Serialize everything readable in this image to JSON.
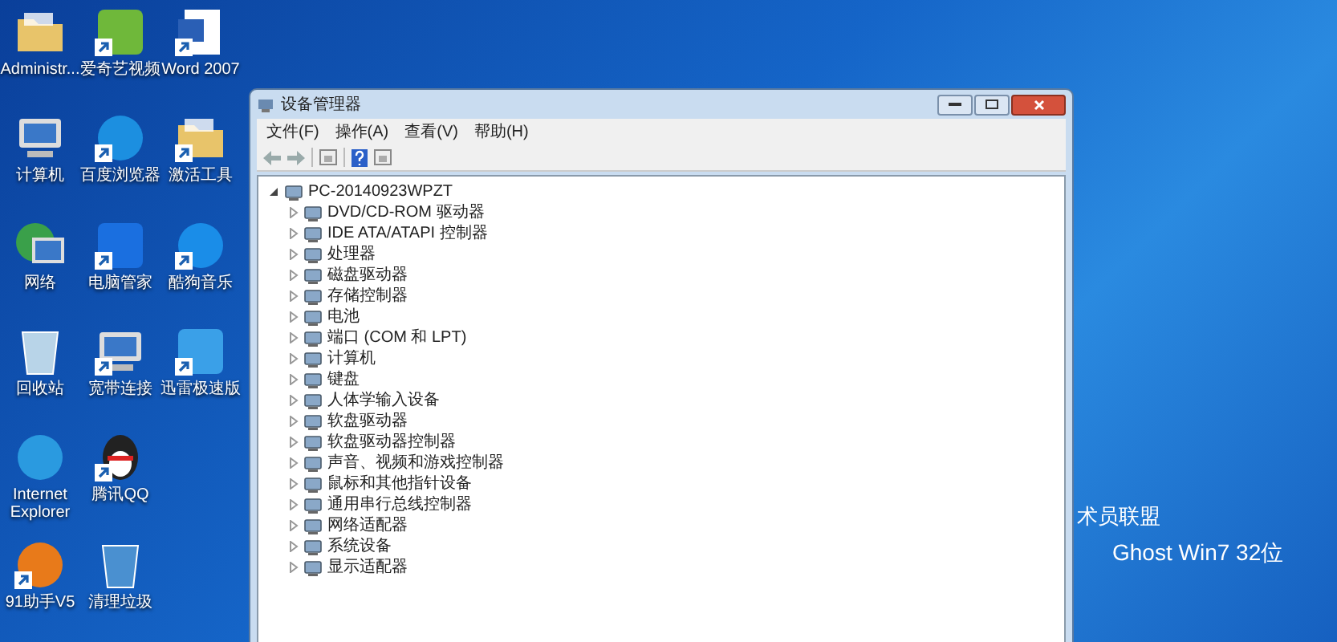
{
  "desktop_rows": [
    [
      {
        "label": "Administr...",
        "kind": "folder",
        "color": "#e8c46a",
        "shortcut": false
      },
      {
        "label": "爱奇艺视频",
        "kind": "tile",
        "color": "#6fb83a",
        "shortcut": true
      },
      {
        "label": "Word 2007",
        "kind": "doc",
        "color": "#2a5fb5",
        "shortcut": true
      }
    ],
    [
      {
        "label": "计算机",
        "kind": "computer",
        "color": "#3a78c8",
        "shortcut": false
      },
      {
        "label": "百度浏览器",
        "kind": "round",
        "color": "#1c8fe0",
        "shortcut": true
      },
      {
        "label": "激活工具",
        "kind": "folder",
        "color": "#e8c46a",
        "shortcut": true
      }
    ],
    [
      {
        "label": "网络",
        "kind": "globe",
        "color": "#3aa04a",
        "shortcut": false
      },
      {
        "label": "电脑管家",
        "kind": "tile",
        "color": "#1a6fe0",
        "shortcut": true
      },
      {
        "label": "酷狗音乐",
        "kind": "round",
        "color": "#1a8de8",
        "shortcut": true
      }
    ],
    [
      {
        "label": "回收站",
        "kind": "bin",
        "color": "#b8d4e8",
        "shortcut": false
      },
      {
        "label": "宽带连接",
        "kind": "computer",
        "color": "#3a78c8",
        "shortcut": true
      },
      {
        "label": "迅雷极速版",
        "kind": "tile",
        "color": "#3aa0e8",
        "shortcut": true
      }
    ],
    [
      {
        "label": "Internet Explorer",
        "kind": "round",
        "color": "#2a9ae0",
        "shortcut": false
      },
      {
        "label": "腾讯QQ",
        "kind": "penguin",
        "color": "#222222",
        "shortcut": true
      }
    ],
    [
      {
        "label": "91助手V5",
        "kind": "round",
        "color": "#e87a1a",
        "shortcut": true
      },
      {
        "label": "清理垃圾",
        "kind": "bin",
        "color": "#4a90d0",
        "shortcut": false
      }
    ]
  ],
  "wallpaper_text": [
    "术员联盟",
    "Ghost Win7 32位"
  ],
  "window": {
    "title": "设备管理器",
    "menu": [
      "文件(F)",
      "操作(A)",
      "查看(V)",
      "帮助(H)"
    ],
    "tree": {
      "label": "PC-20140923WPZT",
      "expanded": true,
      "children": [
        {
          "label": "DVD/CD-ROM 驱动器",
          "expanded": false
        },
        {
          "label": "IDE ATA/ATAPI 控制器",
          "expanded": false
        },
        {
          "label": "处理器",
          "expanded": false
        },
        {
          "label": "磁盘驱动器",
          "expanded": false
        },
        {
          "label": "存储控制器",
          "expanded": false
        },
        {
          "label": "电池",
          "expanded": false
        },
        {
          "label": "端口 (COM 和 LPT)",
          "expanded": false
        },
        {
          "label": "计算机",
          "expanded": false
        },
        {
          "label": "键盘",
          "expanded": false
        },
        {
          "label": "人体学输入设备",
          "expanded": false
        },
        {
          "label": "软盘驱动器",
          "expanded": false
        },
        {
          "label": "软盘驱动器控制器",
          "expanded": false
        },
        {
          "label": "声音、视频和游戏控制器",
          "expanded": false
        },
        {
          "label": "鼠标和其他指针设备",
          "expanded": false
        },
        {
          "label": "通用串行总线控制器",
          "expanded": false
        },
        {
          "label": "网络适配器",
          "expanded": false
        },
        {
          "label": "系统设备",
          "expanded": false
        },
        {
          "label": "显示适配器",
          "expanded": false
        }
      ]
    }
  }
}
